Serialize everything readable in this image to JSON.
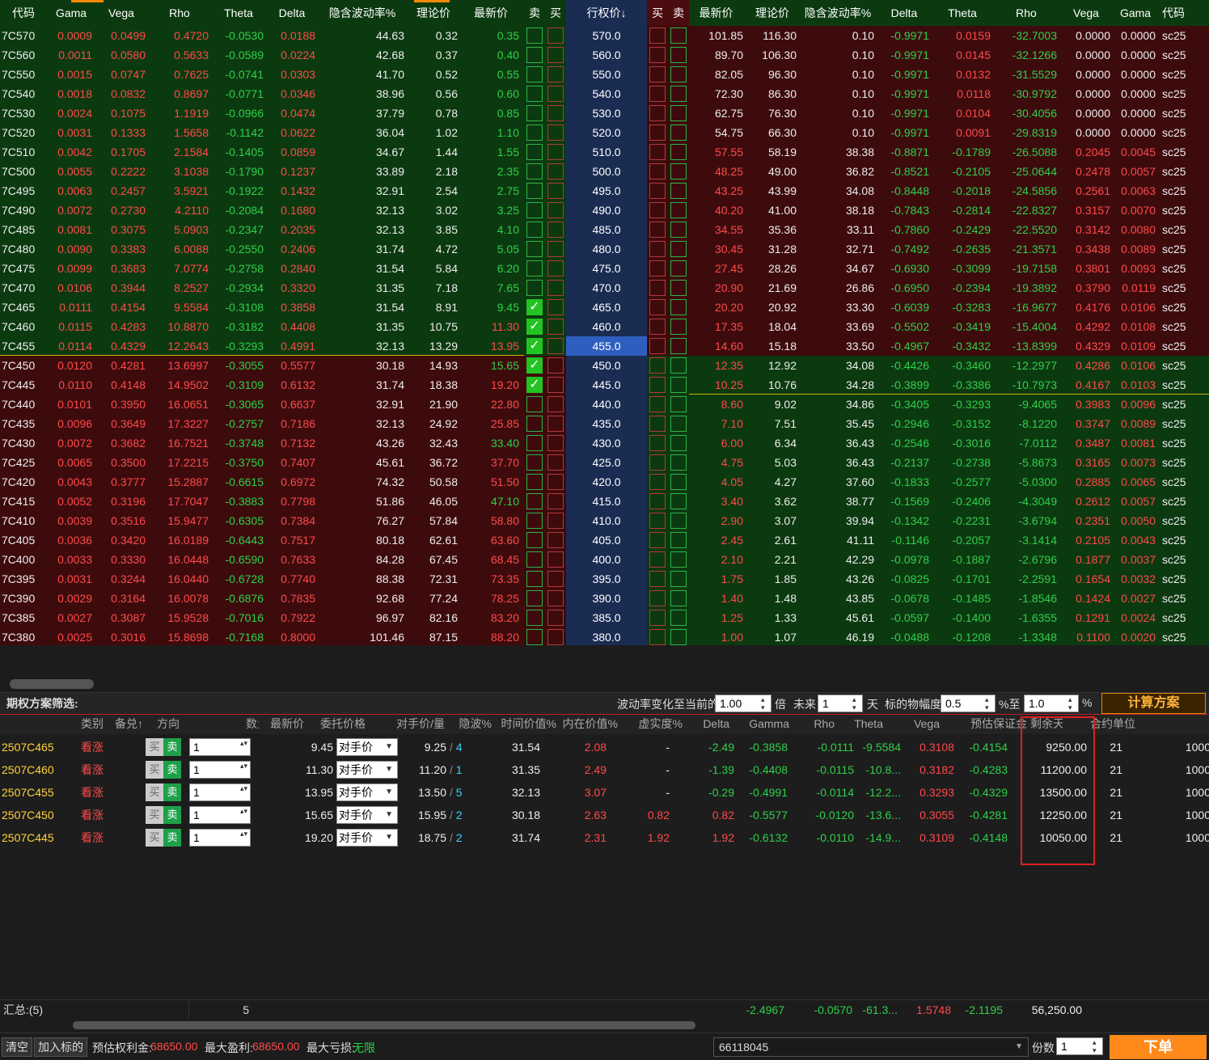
{
  "headers": {
    "left": [
      "代码",
      "Gama",
      "Vega",
      "Rho",
      "Theta",
      "Delta",
      "隐含波动率%",
      "理论价",
      "最新价"
    ],
    "sell": "卖",
    "buy": "买",
    "strike": "行权价↓",
    "right": [
      "最新价",
      "理论价",
      "隐含波动率%",
      "Delta",
      "Theta",
      "Rho",
      "Vega",
      "Gama",
      "代码"
    ]
  },
  "rows": [
    {
      "code": "7C570",
      "g": "0.0009",
      "v": "0.0499",
      "rho": "0.4720",
      "th": "-0.0530",
      "d": "0.0188",
      "iv": "44.63",
      "tp": "0.32",
      "lp": "0.35",
      "k": "570.0",
      "rlp": "101.85",
      "rtp": "116.30",
      "riv": "0.10",
      "rd": "-0.9971",
      "rth": "0.0159",
      "rrho": "-32.7003",
      "rv": "0.0000",
      "rg": "0.0000",
      "rc": "sc25"
    },
    {
      "code": "7C560",
      "g": "0.0011",
      "v": "0.0580",
      "rho": "0.5633",
      "th": "-0.0589",
      "d": "0.0224",
      "iv": "42.68",
      "tp": "0.37",
      "lp": "0.40",
      "k": "560.0",
      "rlp": "89.70",
      "rtp": "106.30",
      "riv": "0.10",
      "rd": "-0.9971",
      "rth": "0.0145",
      "rrho": "-32.1266",
      "rv": "0.0000",
      "rg": "0.0000",
      "rc": "sc25"
    },
    {
      "code": "7C550",
      "g": "0.0015",
      "v": "0.0747",
      "rho": "0.7625",
      "th": "-0.0741",
      "d": "0.0303",
      "iv": "41.70",
      "tp": "0.52",
      "lp": "0.55",
      "k": "550.0",
      "rlp": "82.05",
      "rtp": "96.30",
      "riv": "0.10",
      "rd": "-0.9971",
      "rth": "0.0132",
      "rrho": "-31.5529",
      "rv": "0.0000",
      "rg": "0.0000",
      "rc": "sc25"
    },
    {
      "code": "7C540",
      "g": "0.0018",
      "v": "0.0832",
      "rho": "0.8697",
      "th": "-0.0771",
      "d": "0.0346",
      "iv": "38.96",
      "tp": "0.56",
      "lp": "0.60",
      "k": "540.0",
      "rlp": "72.30",
      "rtp": "86.30",
      "riv": "0.10",
      "rd": "-0.9971",
      "rth": "0.0118",
      "rrho": "-30.9792",
      "rv": "0.0000",
      "rg": "0.0000",
      "rc": "sc25"
    },
    {
      "code": "7C530",
      "g": "0.0024",
      "v": "0.1075",
      "rho": "1.1919",
      "th": "-0.0966",
      "d": "0.0474",
      "iv": "37.79",
      "tp": "0.78",
      "lp": "0.85",
      "k": "530.0",
      "rlp": "62.75",
      "rtp": "76.30",
      "riv": "0.10",
      "rd": "-0.9971",
      "rth": "0.0104",
      "rrho": "-30.4056",
      "rv": "0.0000",
      "rg": "0.0000",
      "rc": "sc25"
    },
    {
      "code": "7C520",
      "g": "0.0031",
      "v": "0.1333",
      "rho": "1.5658",
      "th": "-0.1142",
      "d": "0.0622",
      "iv": "36.04",
      "tp": "1.02",
      "lp": "1.10",
      "k": "520.0",
      "rlp": "54.75",
      "rtp": "66.30",
      "riv": "0.10",
      "rd": "-0.9971",
      "rth": "0.0091",
      "rrho": "-29.8319",
      "rv": "0.0000",
      "rg": "0.0000",
      "rc": "sc25"
    },
    {
      "code": "7C510",
      "g": "0.0042",
      "v": "0.1705",
      "rho": "2.1584",
      "th": "-0.1405",
      "d": "0.0859",
      "iv": "34.67",
      "tp": "1.44",
      "lp": "1.55",
      "k": "510.0",
      "rlp": "57.55",
      "rtp": "58.19",
      "riv": "38.38",
      "rd": "-0.8871",
      "rth": "-0.1789",
      "rrho": "-26.5088",
      "rv": "0.2045",
      "rg": "0.0045",
      "rc": "sc25"
    },
    {
      "code": "7C500",
      "g": "0.0055",
      "v": "0.2222",
      "rho": "3.1038",
      "th": "-0.1790",
      "d": "0.1237",
      "iv": "33.89",
      "tp": "2.18",
      "lp": "2.35",
      "k": "500.0",
      "rlp": "48.25",
      "rtp": "49.00",
      "riv": "36.82",
      "rd": "-0.8521",
      "rth": "-0.2105",
      "rrho": "-25.0644",
      "rv": "0.2478",
      "rg": "0.0057",
      "rc": "sc25"
    },
    {
      "code": "7C495",
      "g": "0.0063",
      "v": "0.2457",
      "rho": "3.5921",
      "th": "-0.1922",
      "d": "0.1432",
      "iv": "32.91",
      "tp": "2.54",
      "lp": "2.75",
      "k": "495.0",
      "rlp": "43.25",
      "rtp": "43.99",
      "riv": "34.08",
      "rd": "-0.8448",
      "rth": "-0.2018",
      "rrho": "-24.5856",
      "rv": "0.2561",
      "rg": "0.0063",
      "rc": "sc25"
    },
    {
      "code": "7C490",
      "g": "0.0072",
      "v": "0.2730",
      "rho": "4.2110",
      "th": "-0.2084",
      "d": "0.1680",
      "iv": "32.13",
      "tp": "3.02",
      "lp": "3.25",
      "k": "490.0",
      "rlp": "40.20",
      "rtp": "41.00",
      "riv": "38.18",
      "rd": "-0.7843",
      "rth": "-0.2814",
      "rrho": "-22.8327",
      "rv": "0.3157",
      "rg": "0.0070",
      "rc": "sc25"
    },
    {
      "code": "7C485",
      "g": "0.0081",
      "v": "0.3075",
      "rho": "5.0903",
      "th": "-0.2347",
      "d": "0.2035",
      "iv": "32.13",
      "tp": "3.85",
      "lp": "4.10",
      "k": "485.0",
      "rlp": "34.55",
      "rtp": "35.36",
      "riv": "33.11",
      "rd": "-0.7860",
      "rth": "-0.2429",
      "rrho": "-22.5520",
      "rv": "0.3142",
      "rg": "0.0080",
      "rc": "sc25"
    },
    {
      "code": "7C480",
      "g": "0.0090",
      "v": "0.3383",
      "rho": "6.0088",
      "th": "-0.2550",
      "d": "0.2406",
      "iv": "31.74",
      "tp": "4.72",
      "lp": "5.05",
      "k": "480.0",
      "rlp": "30.45",
      "rtp": "31.28",
      "riv": "32.71",
      "rd": "-0.7492",
      "rth": "-0.2635",
      "rrho": "-21.3571",
      "rv": "0.3438",
      "rg": "0.0089",
      "rc": "sc25"
    },
    {
      "code": "7C475",
      "g": "0.0099",
      "v": "0.3683",
      "rho": "7.0774",
      "th": "-0.2758",
      "d": "0.2840",
      "iv": "31.54",
      "tp": "5.84",
      "lp": "6.20",
      "k": "475.0",
      "rlp": "27.45",
      "rtp": "28.26",
      "riv": "34.67",
      "rd": "-0.6930",
      "rth": "-0.3099",
      "rrho": "-19.7158",
      "rv": "0.3801",
      "rg": "0.0093",
      "rc": "sc25"
    },
    {
      "code": "7C470",
      "g": "0.0106",
      "v": "0.3944",
      "rho": "8.2527",
      "th": "-0.2934",
      "d": "0.3320",
      "iv": "31.35",
      "tp": "7.18",
      "lp": "7.65",
      "k": "470.0",
      "rlp": "20.90",
      "rtp": "21.69",
      "riv": "26.86",
      "rd": "-0.6950",
      "rth": "-0.2394",
      "rrho": "-19.3892",
      "rv": "0.3790",
      "rg": "0.0119",
      "rc": "sc25"
    },
    {
      "code": "7C465",
      "g": "0.0111",
      "v": "0.4154",
      "rho": "9.5584",
      "th": "-0.3108",
      "d": "0.3858",
      "iv": "31.54",
      "tp": "8.91",
      "lp": "9.45",
      "k": "465.0",
      "rlp": "20.20",
      "rtp": "20.92",
      "riv": "33.30",
      "rd": "-0.6039",
      "rth": "-0.3283",
      "rrho": "-16.9677",
      "rv": "0.4176",
      "rg": "0.0106",
      "rc": "sc25"
    },
    {
      "code": "7C460",
      "g": "0.0115",
      "v": "0.4283",
      "rho": "10.8870",
      "th": "-0.3182",
      "d": "0.4408",
      "iv": "31.35",
      "tp": "10.75",
      "lp": "11.30",
      "k": "460.0",
      "rlp": "17.35",
      "rtp": "18.04",
      "riv": "33.69",
      "rd": "-0.5502",
      "rth": "-0.3419",
      "rrho": "-15.4004",
      "rv": "0.4292",
      "rg": "0.0108",
      "rc": "sc25"
    },
    {
      "code": "7C455",
      "g": "0.0114",
      "v": "0.4329",
      "rho": "12.2643",
      "th": "-0.3293",
      "d": "0.4991",
      "iv": "32.13",
      "tp": "13.29",
      "lp": "13.95",
      "k": "455.0",
      "rlp": "14.60",
      "rtp": "15.18",
      "riv": "33.50",
      "rd": "-0.4967",
      "rth": "-0.3432",
      "rrho": "-13.8399",
      "rv": "0.4329",
      "rg": "0.0109",
      "rc": "sc25"
    },
    {
      "code": "7C450",
      "g": "0.0120",
      "v": "0.4281",
      "rho": "13.6997",
      "th": "-0.3055",
      "d": "0.5577",
      "iv": "30.18",
      "tp": "14.93",
      "lp": "15.65",
      "k": "450.0",
      "rlp": "12.35",
      "rtp": "12.92",
      "riv": "34.08",
      "rd": "-0.4426",
      "rth": "-0.3460",
      "rrho": "-12.2977",
      "rv": "0.4286",
      "rg": "0.0106",
      "rc": "sc25"
    },
    {
      "code": "7C445",
      "g": "0.0110",
      "v": "0.4148",
      "rho": "14.9502",
      "th": "-0.3109",
      "d": "0.6132",
      "iv": "31.74",
      "tp": "18.38",
      "lp": "19.20",
      "k": "445.0",
      "rlp": "10.25",
      "rtp": "10.76",
      "riv": "34.28",
      "rd": "-0.3899",
      "rth": "-0.3386",
      "rrho": "-10.7973",
      "rv": "0.4167",
      "rg": "0.0103",
      "rc": "sc25"
    },
    {
      "code": "7C440",
      "g": "0.0101",
      "v": "0.3950",
      "rho": "16.0651",
      "th": "-0.3065",
      "d": "0.6637",
      "iv": "32.91",
      "tp": "21.90",
      "lp": "22.80",
      "k": "440.0",
      "rlp": "8.60",
      "rtp": "9.02",
      "riv": "34.86",
      "rd": "-0.3405",
      "rth": "-0.3293",
      "rrho": "-9.4065",
      "rv": "0.3983",
      "rg": "0.0096",
      "rc": "sc25"
    },
    {
      "code": "7C435",
      "g": "0.0096",
      "v": "0.3649",
      "rho": "17.3227",
      "th": "-0.2757",
      "d": "0.7186",
      "iv": "32.13",
      "tp": "24.92",
      "lp": "25.85",
      "k": "435.0",
      "rlp": "7.10",
      "rtp": "7.51",
      "riv": "35.45",
      "rd": "-0.2946",
      "rth": "-0.3152",
      "rrho": "-8.1220",
      "rv": "0.3747",
      "rg": "0.0089",
      "rc": "sc25"
    },
    {
      "code": "7C430",
      "g": "0.0072",
      "v": "0.3682",
      "rho": "16.7521",
      "th": "-0.3748",
      "d": "0.7132",
      "iv": "43.26",
      "tp": "32.43",
      "lp": "33.40",
      "k": "430.0",
      "rlp": "6.00",
      "rtp": "6.34",
      "riv": "36.43",
      "rd": "-0.2546",
      "rth": "-0.3016",
      "rrho": "-7.0112",
      "rv": "0.3487",
      "rg": "0.0081",
      "rc": "sc25"
    },
    {
      "code": "7C425",
      "g": "0.0065",
      "v": "0.3500",
      "rho": "17.2215",
      "th": "-0.3750",
      "d": "0.7407",
      "iv": "45.61",
      "tp": "36.72",
      "lp": "37.70",
      "k": "425.0",
      "rlp": "4.75",
      "rtp": "5.03",
      "riv": "36.43",
      "rd": "-0.2137",
      "rth": "-0.2738",
      "rrho": "-5.8673",
      "rv": "0.3165",
      "rg": "0.0073",
      "rc": "sc25"
    },
    {
      "code": "7C420",
      "g": "0.0043",
      "v": "0.3777",
      "rho": "15.2887",
      "th": "-0.6615",
      "d": "0.6972",
      "iv": "74.32",
      "tp": "50.58",
      "lp": "51.50",
      "k": "420.0",
      "rlp": "4.05",
      "rtp": "4.27",
      "riv": "37.60",
      "rd": "-0.1833",
      "rth": "-0.2577",
      "rrho": "-5.0300",
      "rv": "0.2885",
      "rg": "0.0065",
      "rc": "sc25"
    },
    {
      "code": "7C415",
      "g": "0.0052",
      "v": "0.3196",
      "rho": "17.7047",
      "th": "-0.3883",
      "d": "0.7798",
      "iv": "51.86",
      "tp": "46.05",
      "lp": "47.10",
      "k": "415.0",
      "rlp": "3.40",
      "rtp": "3.62",
      "riv": "38.77",
      "rd": "-0.1569",
      "rth": "-0.2406",
      "rrho": "-4.3049",
      "rv": "0.2612",
      "rg": "0.0057",
      "rc": "sc25"
    },
    {
      "code": "7C410",
      "g": "0.0039",
      "v": "0.3516",
      "rho": "15.9477",
      "th": "-0.6305",
      "d": "0.7384",
      "iv": "76.27",
      "tp": "57.84",
      "lp": "58.80",
      "k": "410.0",
      "rlp": "2.90",
      "rtp": "3.07",
      "riv": "39.94",
      "rd": "-0.1342",
      "rth": "-0.2231",
      "rrho": "-3.6794",
      "rv": "0.2351",
      "rg": "0.0050",
      "rc": "sc25"
    },
    {
      "code": "7C405",
      "g": "0.0036",
      "v": "0.3420",
      "rho": "16.0189",
      "th": "-0.6443",
      "d": "0.7517",
      "iv": "80.18",
      "tp": "62.61",
      "lp": "63.60",
      "k": "405.0",
      "rlp": "2.45",
      "rtp": "2.61",
      "riv": "41.11",
      "rd": "-0.1146",
      "rth": "-0.2057",
      "rrho": "-3.1414",
      "rv": "0.2105",
      "rg": "0.0043",
      "rc": "sc25"
    },
    {
      "code": "7C400",
      "g": "0.0033",
      "v": "0.3330",
      "rho": "16.0448",
      "th": "-0.6590",
      "d": "0.7633",
      "iv": "84.28",
      "tp": "67.45",
      "lp": "68.45",
      "k": "400.0",
      "rlp": "2.10",
      "rtp": "2.21",
      "riv": "42.29",
      "rd": "-0.0978",
      "rth": "-0.1887",
      "rrho": "-2.6796",
      "rv": "0.1877",
      "rg": "0.0037",
      "rc": "sc25"
    },
    {
      "code": "7C395",
      "g": "0.0031",
      "v": "0.3244",
      "rho": "16.0440",
      "th": "-0.6728",
      "d": "0.7740",
      "iv": "88.38",
      "tp": "72.31",
      "lp": "73.35",
      "k": "395.0",
      "rlp": "1.75",
      "rtp": "1.85",
      "riv": "43.26",
      "rd": "-0.0825",
      "rth": "-0.1701",
      "rrho": "-2.2591",
      "rv": "0.1654",
      "rg": "0.0032",
      "rc": "sc25"
    },
    {
      "code": "7C390",
      "g": "0.0029",
      "v": "0.3164",
      "rho": "16.0078",
      "th": "-0.6876",
      "d": "0.7835",
      "iv": "92.68",
      "tp": "77.24",
      "lp": "78.25",
      "k": "390.0",
      "rlp": "1.40",
      "rtp": "1.48",
      "riv": "43.85",
      "rd": "-0.0678",
      "rth": "-0.1485",
      "rrho": "-1.8546",
      "rv": "0.1424",
      "rg": "0.0027",
      "rc": "sc25"
    },
    {
      "code": "7C385",
      "g": "0.0027",
      "v": "0.3087",
      "rho": "15.9528",
      "th": "-0.7016",
      "d": "0.7922",
      "iv": "96.97",
      "tp": "82.16",
      "lp": "83.20",
      "k": "385.0",
      "rlp": "1.25",
      "rtp": "1.33",
      "riv": "45.61",
      "rd": "-0.0597",
      "rth": "-0.1400",
      "rrho": "-1.6355",
      "rv": "0.1291",
      "rg": "0.0024",
      "rc": "sc25"
    },
    {
      "code": "7C380",
      "g": "0.0025",
      "v": "0.3016",
      "rho": "15.8698",
      "th": "-0.7168",
      "d": "0.8000",
      "iv": "101.46",
      "tp": "87.15",
      "lp": "88.20",
      "k": "380.0",
      "rlp": "1.00",
      "rtp": "1.07",
      "riv": "46.19",
      "rd": "-0.0488",
      "rth": "-0.1208",
      "rrho": "-1.3348",
      "rv": "0.1100",
      "rg": "0.0020",
      "rc": "sc25"
    }
  ],
  "filter": {
    "title": "期权方案筛选:",
    "vol_label": "波动率变化至当前的",
    "vol_value": "1.00",
    "vol_unit": "倍",
    "future_label": "未来",
    "future_value": "1",
    "future_unit": "天",
    "amp_label": "标的物幅度",
    "amp_from": "0.5",
    "amp_to_label": "%至",
    "amp_to": "1.0",
    "amp_unit": "%",
    "calc_button": "计算方案"
  },
  "plan_headers": [
    "类别",
    "备兑↑",
    "方向",
    "数量",
    "最新价",
    "委托价格",
    "对手价/量",
    "隐波%",
    "时间价值%",
    "内在价值%",
    "虚实度%",
    "Delta",
    "Gamma",
    "Rho",
    "Theta",
    "Vega",
    "预估保证金",
    "剩余天数",
    "合约单位"
  ],
  "plan": [
    {
      "code": "2507C465",
      "type": "看涨",
      "buy": "买",
      "sell": "卖",
      "qty": "1",
      "last": "9.45",
      "price": "对手价",
      "cp": "9.25",
      "cq": "4",
      "iv": "31.54",
      "tv": "2.08",
      "iv2": "-",
      "mo": "-2.49",
      "d": "-0.3858",
      "g": "-0.0111",
      "rho": "-9.5584",
      "th": "0.3108",
      "v": "-0.4154",
      "margin": "9250.00",
      "days": "21",
      "unit": "1000"
    },
    {
      "code": "2507C460",
      "type": "看涨",
      "buy": "买",
      "sell": "卖",
      "qty": "1",
      "last": "11.30",
      "price": "对手价",
      "cp": "11.20",
      "cq": "1",
      "iv": "31.35",
      "tv": "2.49",
      "iv2": "-",
      "mo": "-1.39",
      "d": "-0.4408",
      "g": "-0.0115",
      "rho": "-10.8...",
      "th": "0.3182",
      "v": "-0.4283",
      "margin": "11200.00",
      "days": "21",
      "unit": "1000"
    },
    {
      "code": "2507C455",
      "type": "看涨",
      "buy": "买",
      "sell": "卖",
      "qty": "1",
      "last": "13.95",
      "price": "对手价",
      "cp": "13.50",
      "cq": "5",
      "iv": "32.13",
      "tv": "3.07",
      "iv2": "-",
      "mo": "-0.29",
      "d": "-0.4991",
      "g": "-0.0114",
      "rho": "-12.2...",
      "th": "0.3293",
      "v": "-0.4329",
      "margin": "13500.00",
      "days": "21",
      "unit": "1000"
    },
    {
      "code": "2507C450",
      "type": "看涨",
      "buy": "买",
      "sell": "卖",
      "qty": "1",
      "last": "15.65",
      "price": "对手价",
      "cp": "15.95",
      "cq": "2",
      "iv": "30.18",
      "tv": "2.63",
      "iv2": "0.82",
      "mo": "0.82",
      "d": "-0.5577",
      "g": "-0.0120",
      "rho": "-13.6...",
      "th": "0.3055",
      "v": "-0.4281",
      "margin": "12250.00",
      "days": "21",
      "unit": "1000"
    },
    {
      "code": "2507C445",
      "type": "看涨",
      "buy": "买",
      "sell": "卖",
      "qty": "1",
      "last": "19.20",
      "price": "对手价",
      "cp": "18.75",
      "cq": "2",
      "iv": "31.74",
      "tv": "2.31",
      "iv2": "1.92",
      "mo": "1.92",
      "d": "-0.6132",
      "g": "-0.0110",
      "rho": "-14.9...",
      "th": "0.3109",
      "v": "-0.4148",
      "margin": "10050.00",
      "days": "21",
      "unit": "1000"
    }
  ],
  "summary": {
    "label": "汇总:(5)",
    "qty": "5",
    "delta": "-2.4967",
    "gamma": "-0.0570",
    "rho": "-61.3...",
    "theta": "1.5748",
    "vega": "-2.1195",
    "margin": "56,250.00"
  },
  "bottom": {
    "clear": "清空",
    "add": "加入标的",
    "premium_label": "预估权利金:",
    "premium": "68650.00",
    "maxprofit_label": "最大盈利:",
    "maxprofit": "68650.00",
    "maxloss_label": "最大亏损:",
    "maxloss": "无限",
    "account": "66118045",
    "copies_label": "份数",
    "copies": "1",
    "order": "下单"
  }
}
